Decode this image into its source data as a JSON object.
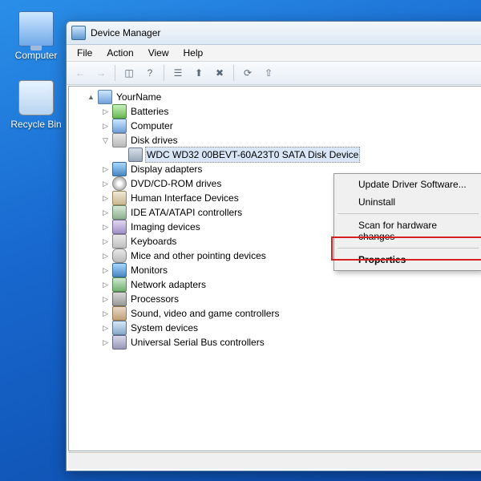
{
  "desktop": {
    "icons": [
      {
        "label": "Computer",
        "kind": "computer"
      },
      {
        "label": "Recycle Bin",
        "kind": "bin"
      }
    ]
  },
  "window": {
    "title": "Device Manager",
    "menubar": [
      "File",
      "Action",
      "View",
      "Help"
    ],
    "toolbar": {
      "back": "←",
      "forward": "→",
      "up": "⇧",
      "show_hidden": "◫",
      "help": "?",
      "props": "☰",
      "scan": "⟳",
      "update": "⬆",
      "uninstall": "✖"
    }
  },
  "tree": {
    "root": "YourName",
    "nodes": [
      {
        "label": "Batteries",
        "icon": "batt",
        "expanded": false
      },
      {
        "label": "Computer",
        "icon": "pc",
        "expanded": false
      },
      {
        "label": "Disk drives",
        "icon": "disk",
        "expanded": true,
        "children": [
          {
            "label": "WDC WD32 00BEVT-60A23T0 SATA Disk Device",
            "icon": "hdd",
            "selected": true
          }
        ]
      },
      {
        "label": "Display adapters",
        "icon": "disp",
        "expanded": false
      },
      {
        "label": "DVD/CD-ROM drives",
        "icon": "dvd",
        "expanded": false
      },
      {
        "label": "Human Interface Devices",
        "icon": "hid",
        "expanded": false
      },
      {
        "label": "IDE ATA/ATAPI controllers",
        "icon": "ide",
        "expanded": false
      },
      {
        "label": "Imaging devices",
        "icon": "img",
        "expanded": false
      },
      {
        "label": "Keyboards",
        "icon": "kbd",
        "expanded": false
      },
      {
        "label": "Mice and other pointing devices",
        "icon": "mouse",
        "expanded": false
      },
      {
        "label": "Monitors",
        "icon": "disp",
        "expanded": false
      },
      {
        "label": "Network adapters",
        "icon": "net",
        "expanded": false
      },
      {
        "label": "Processors",
        "icon": "cpu",
        "expanded": false
      },
      {
        "label": "Sound, video and game controllers",
        "icon": "snd",
        "expanded": false
      },
      {
        "label": "System devices",
        "icon": "sys",
        "expanded": false
      },
      {
        "label": "Universal Serial Bus controllers",
        "icon": "usb",
        "expanded": false
      }
    ]
  },
  "context_menu": {
    "items": [
      {
        "label": "Update Driver Software...",
        "type": "item"
      },
      {
        "label": "Uninstall",
        "type": "item"
      },
      {
        "type": "sep"
      },
      {
        "label": "Scan for hardware changes",
        "type": "item"
      },
      {
        "type": "sep"
      },
      {
        "label": "Properties",
        "type": "item",
        "bold": true,
        "highlighted": true
      }
    ]
  },
  "glyphs": {
    "collapsed": "▷",
    "expanded": "▽",
    "root_expanded": "▲"
  }
}
